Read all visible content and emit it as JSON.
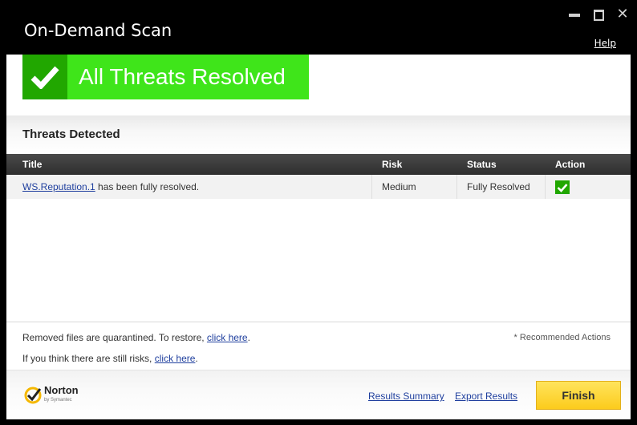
{
  "window": {
    "title": "On-Demand Scan",
    "help_label": "Help"
  },
  "banner": {
    "text": "All Threats Resolved",
    "icon": "checkmark-icon",
    "color": "#3fe51a",
    "icon_bg": "#21a700"
  },
  "section": {
    "title": "Threats Detected"
  },
  "table": {
    "columns": [
      "Title",
      "Risk",
      "Status",
      "Action"
    ],
    "rows": [
      {
        "threat_name": "WS.Reputation.1",
        "message": " has been fully resolved.",
        "risk": "Medium",
        "status": "Fully Resolved",
        "action_icon": "checkmark-icon"
      }
    ]
  },
  "notes": {
    "quarantine_text": "Removed files are quarantined. To restore, ",
    "quarantine_link": "click here",
    "quarantine_end": ".",
    "risk_text": "If you think there are still risks, ",
    "risk_link": "click here",
    "risk_end": ".",
    "recommended": "* Recommended Actions"
  },
  "footer": {
    "brand": "Norton",
    "brand_sub": "by Symantec",
    "results_summary": "Results Summary",
    "export_results": "Export Results",
    "finish_label": "Finish"
  }
}
